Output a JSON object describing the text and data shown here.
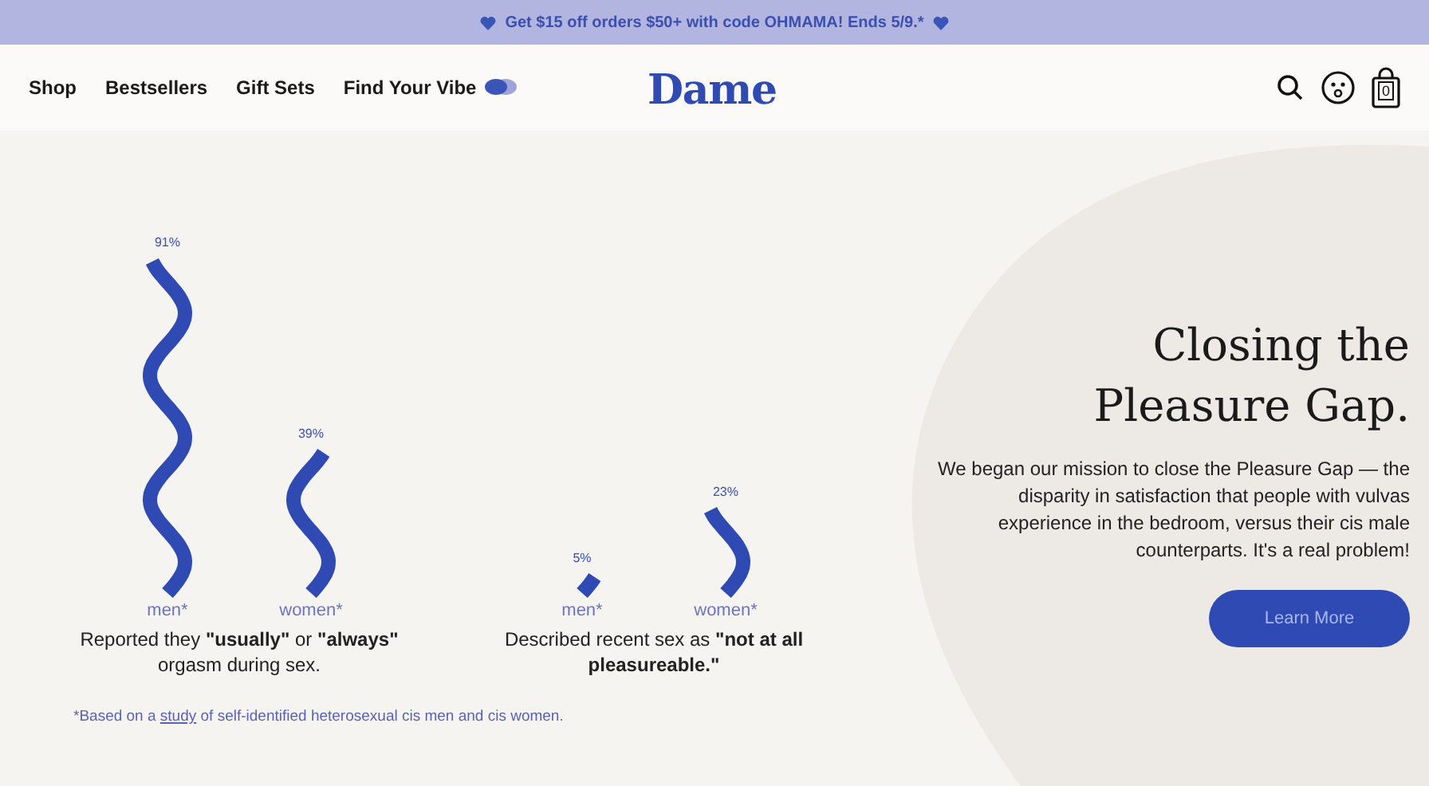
{
  "promo_banner": {
    "text": "Get $15 off orders $50+ with code OHMAMA! Ends 5/9.*"
  },
  "nav": {
    "links": [
      "Shop",
      "Bestsellers",
      "Gift Sets",
      "Find Your Vibe"
    ],
    "logo": "Dame",
    "cart_count": "0"
  },
  "stats": [
    {
      "bars": [
        {
          "value": "91%",
          "label": "men*"
        },
        {
          "value": "39%",
          "label": "women*"
        }
      ],
      "caption": "Reported they **\"usually\"** or **\"always\"** orgasm during sex."
    },
    {
      "bars": [
        {
          "value": "5%",
          "label": "men*"
        },
        {
          "value": "23%",
          "label": "women*"
        }
      ],
      "caption": "Described recent sex as **\"not at all pleasureable.\"**"
    }
  ],
  "footnote": {
    "before": "*Based on a",
    "link": "study",
    "after": "of self-identified heterosexual cis men and cis women."
  },
  "hero": {
    "title": "Closing the Pleasure Gap.",
    "body": "We began our mission to close the Pleasure Gap — the disparity in satisfaction that people with vulvas experience in the bedroom, versus their cis male counterparts. It's a real problem!",
    "button": "Learn More"
  }
}
